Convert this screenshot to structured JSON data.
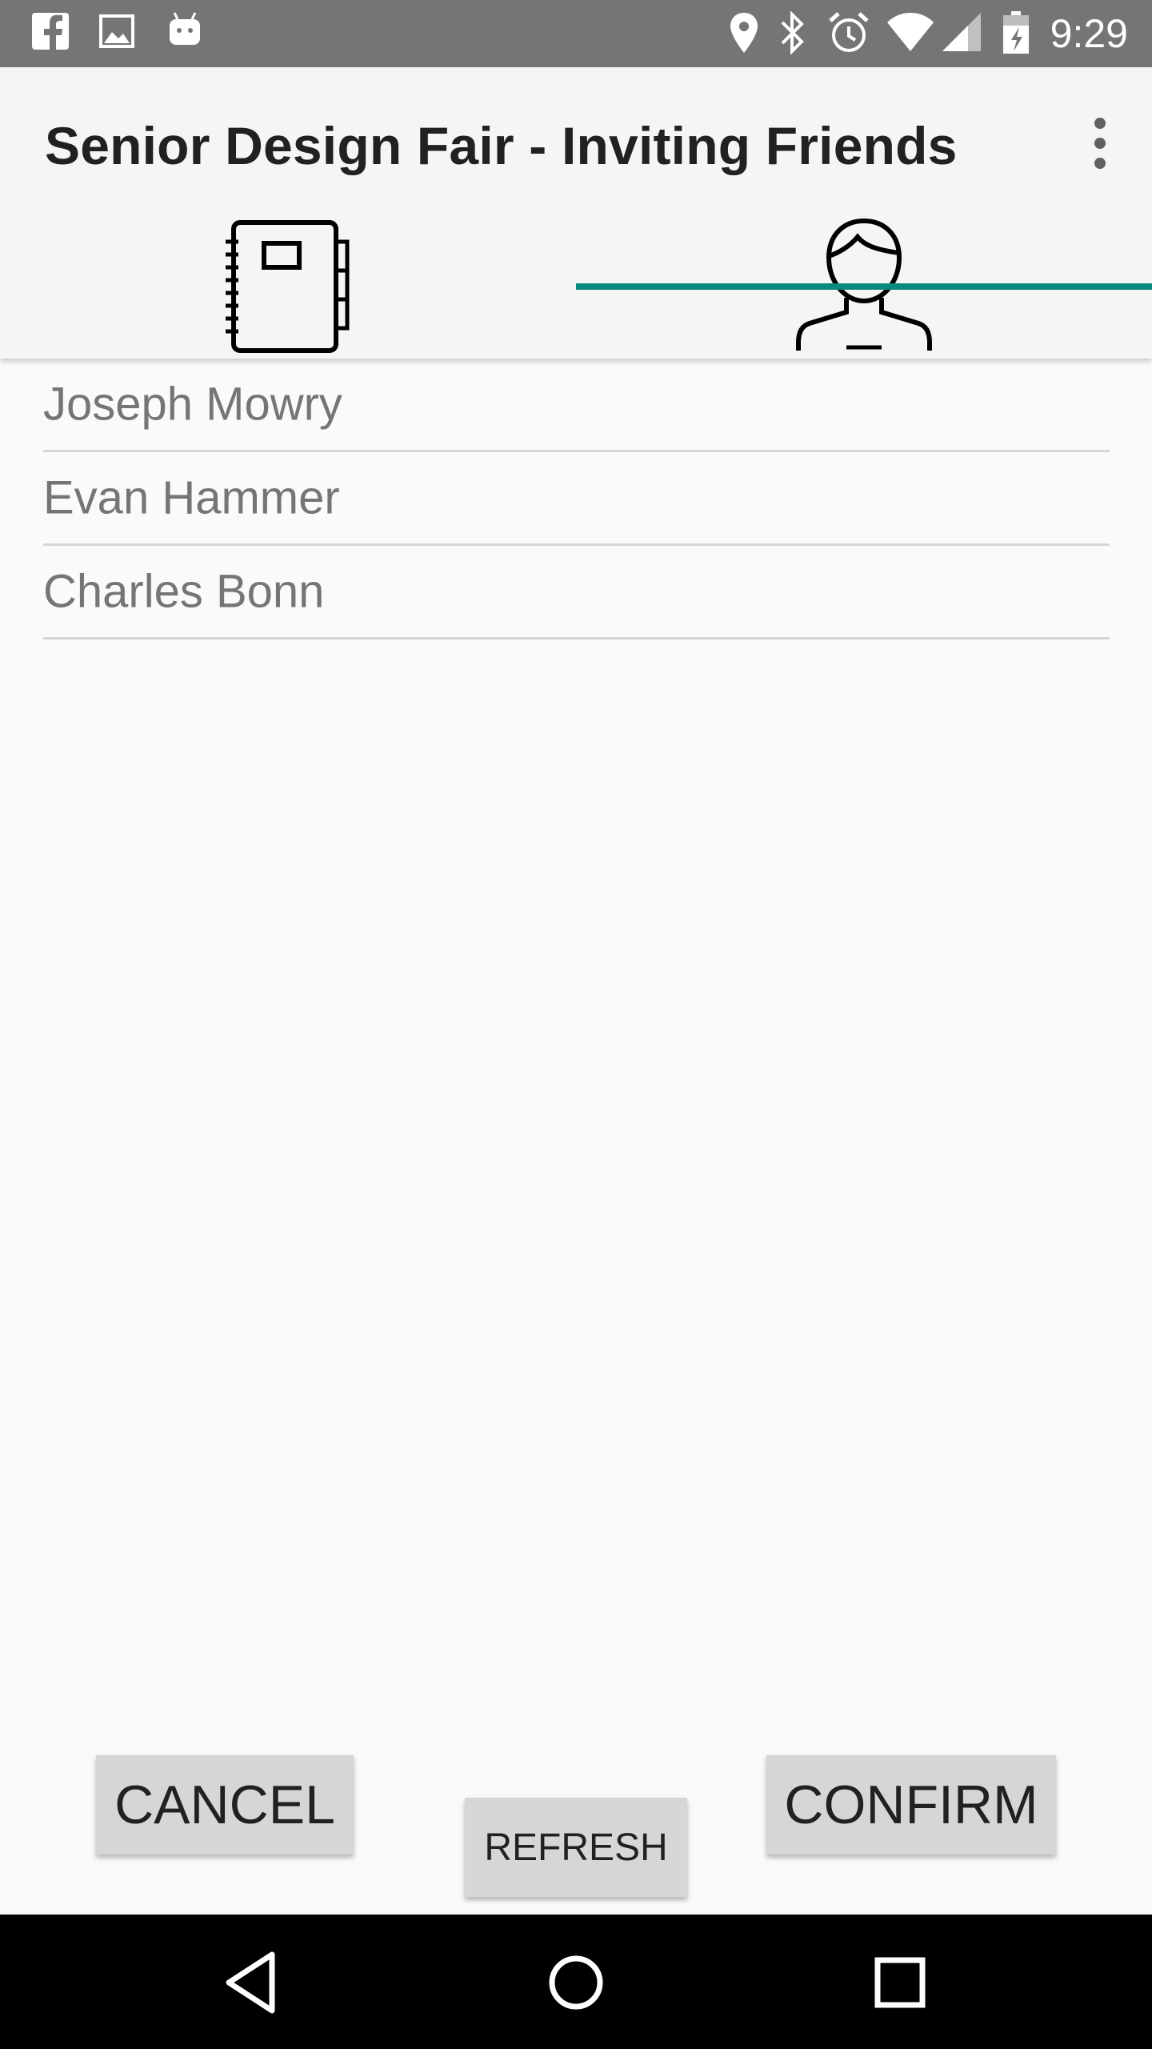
{
  "status_bar": {
    "time": "9:29",
    "left_icons": [
      "facebook-icon",
      "image-icon",
      "android-icon"
    ],
    "right_icons": [
      "location-icon",
      "bluetooth-icon",
      "alarm-icon",
      "wifi-icon",
      "signal-icon",
      "battery-icon"
    ]
  },
  "app_bar": {
    "title": "Senior Design Fair - Inviting Friends",
    "overflow_icon": "more-vert-icon"
  },
  "tabs": [
    {
      "icon": "notebook-icon",
      "selected": false
    },
    {
      "icon": "person-icon",
      "selected": true
    }
  ],
  "friends": [
    {
      "name": "Joseph Mowry"
    },
    {
      "name": "Evan Hammer"
    },
    {
      "name": "Charles Bonn"
    }
  ],
  "buttons": {
    "cancel": "CANCEL",
    "refresh": "REFRESH",
    "confirm": "CONFIRM"
  },
  "nav_bar": {
    "icons": [
      "back-icon",
      "home-icon",
      "recents-icon"
    ]
  },
  "colors": {
    "status_bar": "#757575",
    "app_bar": "#f5f5f5",
    "accent": "#0a8a7c",
    "button": "#d6d6d6",
    "nav_bar": "#000000"
  }
}
